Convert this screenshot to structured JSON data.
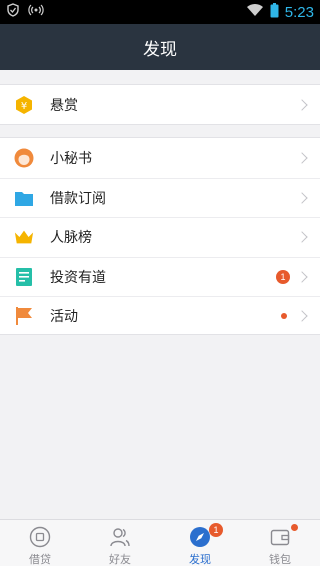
{
  "status_bar": {
    "time": "5:23",
    "icons": [
      "shield-icon",
      "broadcast-icon",
      "wifi-icon",
      "battery-icon"
    ]
  },
  "header": {
    "title": "发现"
  },
  "groups": [
    {
      "items": [
        {
          "label": "悬赏",
          "icon": "reward-yen-icon",
          "color": "#f5b400"
        }
      ]
    },
    {
      "items": [
        {
          "label": "小秘书",
          "icon": "secretary-avatar-icon",
          "color": "#f08a3c"
        },
        {
          "label": "借款订阅",
          "icon": "folder-icon",
          "color": "#2fa7e4"
        },
        {
          "label": "人脉榜",
          "icon": "crown-icon",
          "color": "#f5b400"
        },
        {
          "label": "投资有道",
          "icon": "document-icon",
          "color": "#25bfa8",
          "badge": "1"
        },
        {
          "label": "活动",
          "icon": "flag-icon",
          "color": "#f08a3c",
          "dot": true
        }
      ]
    }
  ],
  "tabs": [
    {
      "label": "借贷",
      "icon": "loan-icon"
    },
    {
      "label": "好友",
      "icon": "friends-icon"
    },
    {
      "label": "发现",
      "icon": "compass-icon",
      "active": true,
      "badge": "1"
    },
    {
      "label": "钱包",
      "icon": "wallet-icon",
      "dot": true
    }
  ],
  "colors": {
    "status_bar_bg": "#000000",
    "nav_bar_bg": "#2a3440",
    "accent": "#2b6fce",
    "badge": "#e75a2c"
  }
}
